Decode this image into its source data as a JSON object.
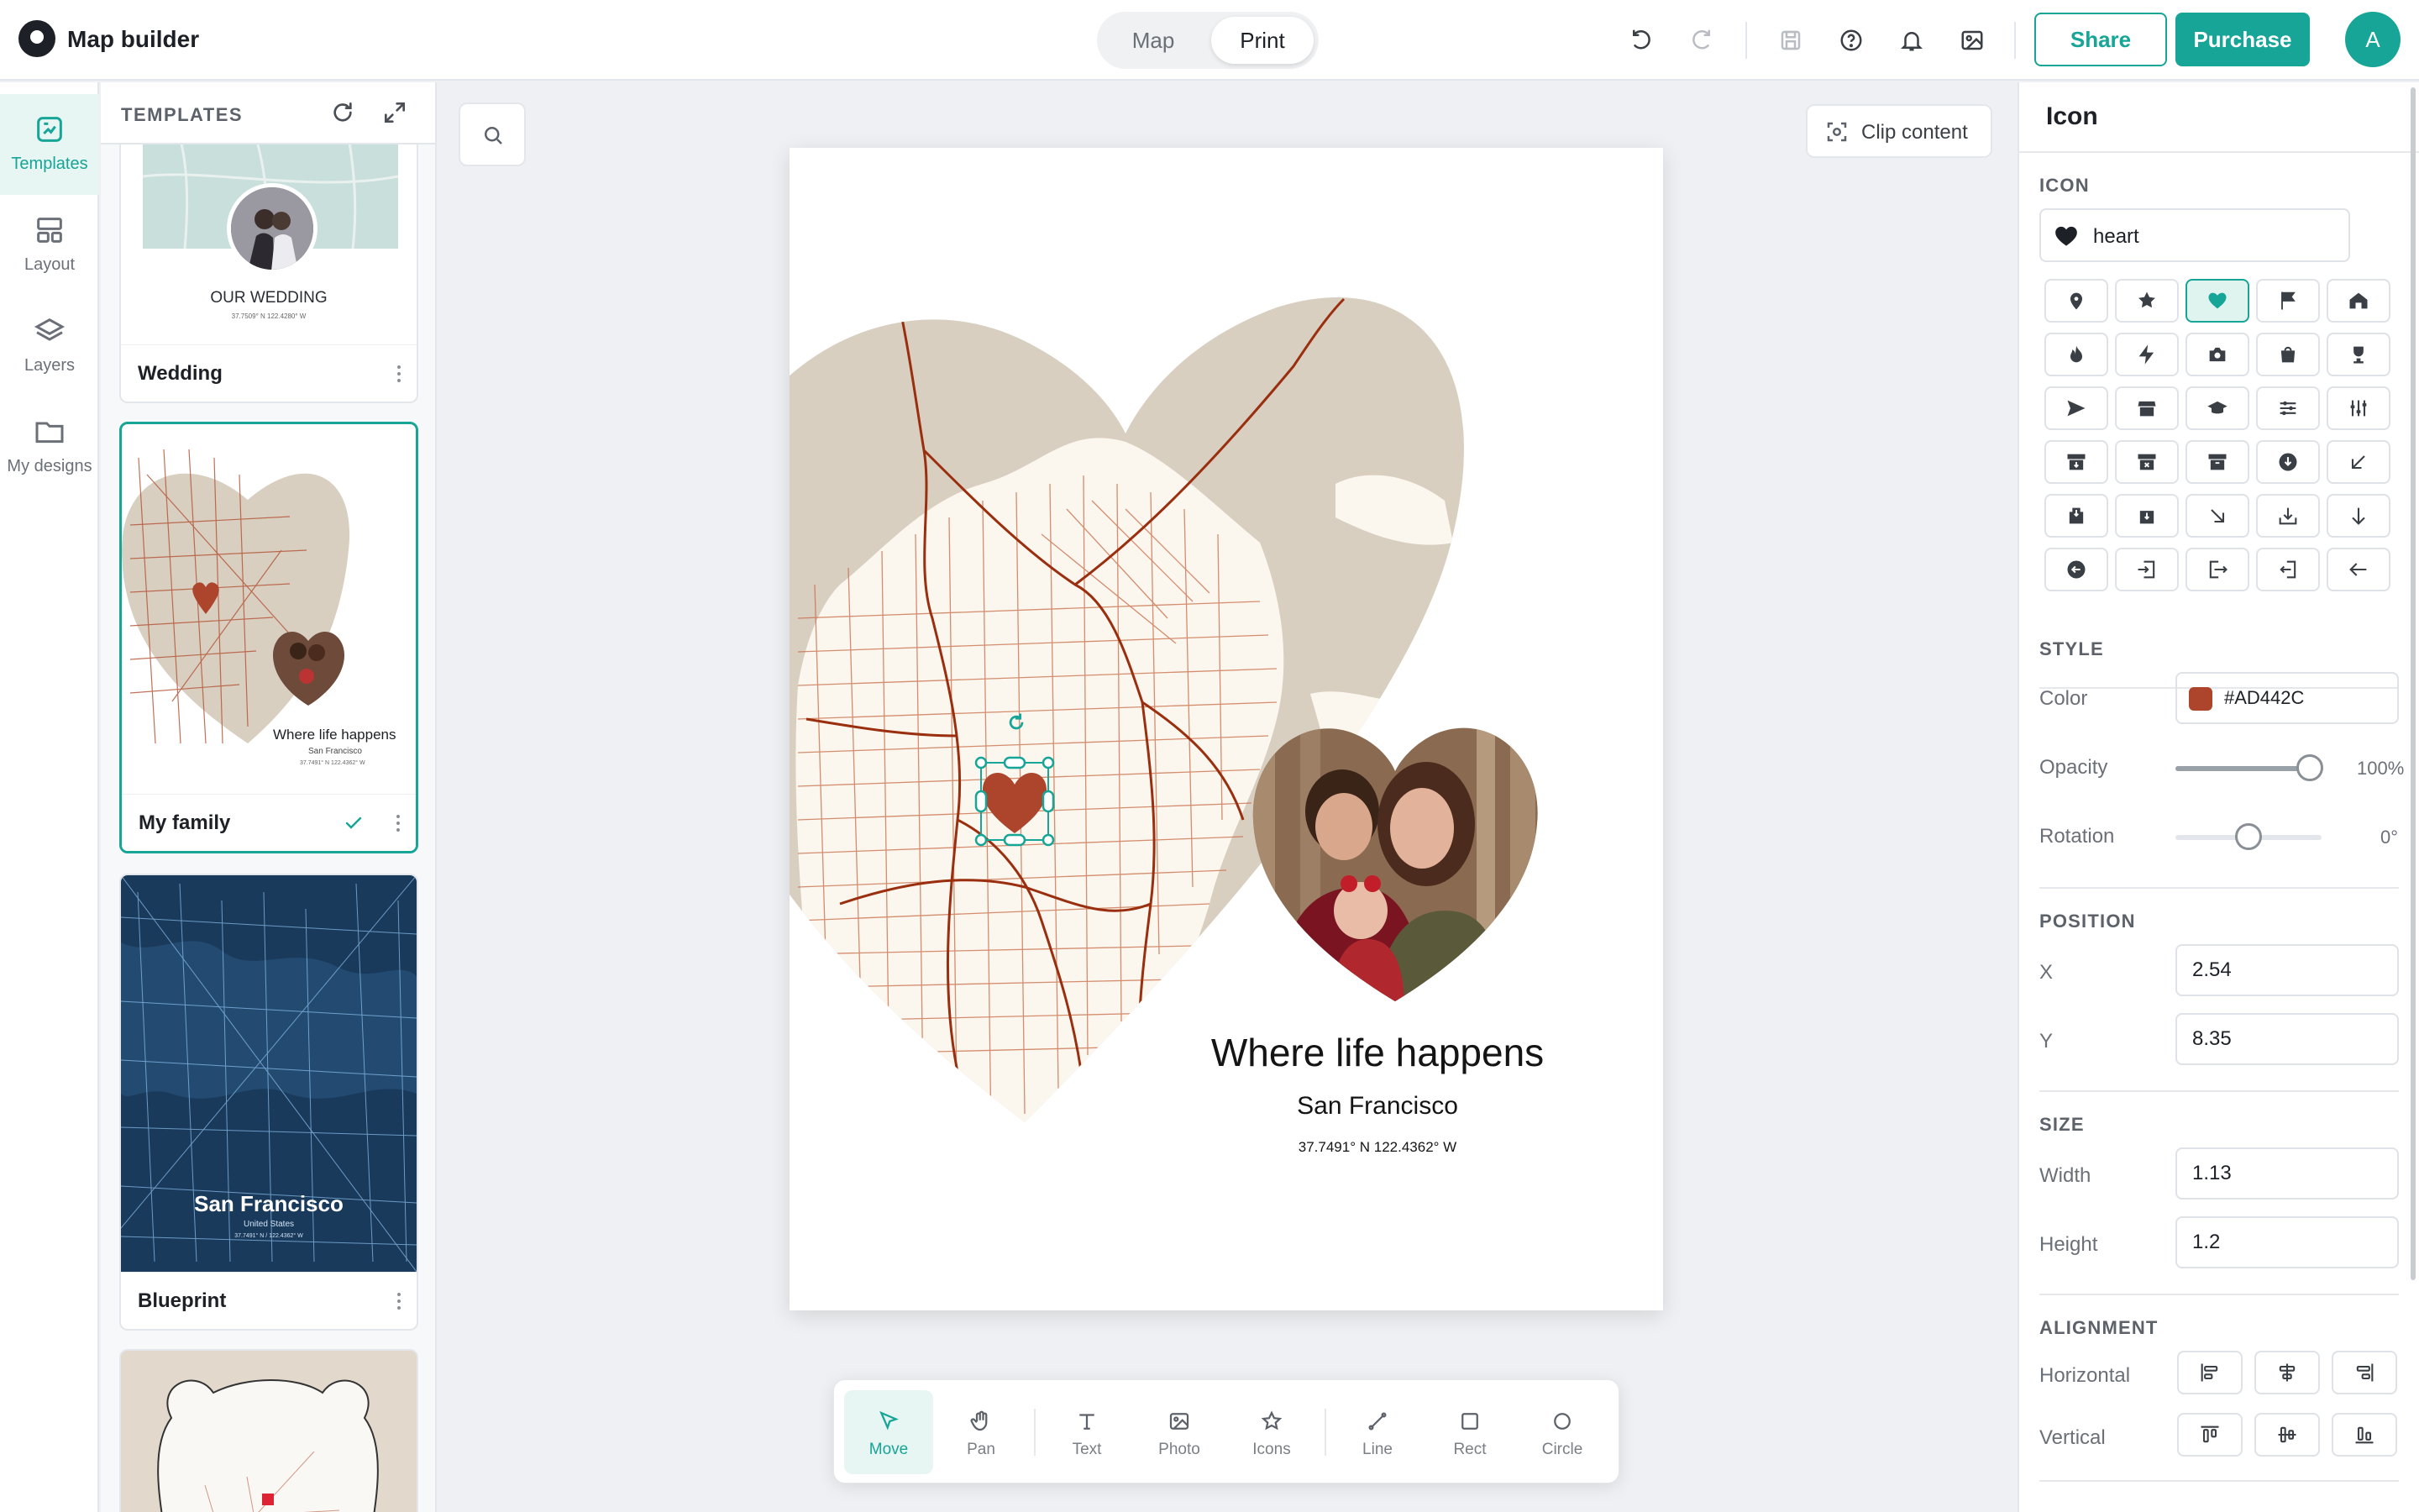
{
  "app": {
    "title": "Map builder"
  },
  "mode_switch": {
    "options": [
      "Map",
      "Print"
    ],
    "active": "Print"
  },
  "header": {
    "share_label": "Share",
    "purchase_label": "Purchase",
    "avatar_initial": "A"
  },
  "rail": {
    "items": [
      {
        "label": "Templates",
        "icon": "templates-icon",
        "active": true
      },
      {
        "label": "Layout",
        "icon": "layout-icon"
      },
      {
        "label": "Layers",
        "icon": "layers-icon"
      },
      {
        "label": "My designs",
        "icon": "folder-icon"
      }
    ]
  },
  "templates": {
    "heading": "TEMPLATES",
    "cards": [
      {
        "name": "Wedding",
        "preview_title": "OUR WEDDING",
        "preview_sub": "37.7509° N 122.4280° W"
      },
      {
        "name": "My family",
        "selected": true,
        "preview_title": "Where life happens",
        "preview_sub": "San Francisco",
        "preview_coords": "37.7491° N 122.4362° W"
      },
      {
        "name": "Blueprint",
        "preview_title": "San Francisco",
        "preview_sub": "United States",
        "preview_coords": "37.7491° N / 122.4362° W"
      },
      {
        "name": ""
      }
    ]
  },
  "canvas": {
    "clip_label": "Clip content",
    "poster": {
      "title": "Where life happens",
      "subtitle": "San Francisco",
      "coords": "37.7491° N  122.4362° W"
    },
    "colors": {
      "land": "#d8cfc1",
      "roads": "#9a2f0f",
      "water": "#fbf6ee",
      "marker": "#AD442C"
    }
  },
  "tools": [
    {
      "label": "Move",
      "icon": "cursor-icon",
      "active": true
    },
    {
      "label": "Pan",
      "icon": "hand-icon"
    },
    {
      "label": "Text",
      "icon": "text-icon"
    },
    {
      "label": "Photo",
      "icon": "photo-icon"
    },
    {
      "label": "Icons",
      "icon": "star-icon"
    },
    {
      "label": "Line",
      "icon": "line-icon"
    },
    {
      "label": "Rect",
      "icon": "rect-icon"
    },
    {
      "label": "Circle",
      "icon": "circle-icon"
    }
  ],
  "properties": {
    "title": "Icon",
    "icon_section": "ICON",
    "icon_value": "heart",
    "icon_grid": [
      "pin",
      "star",
      "heart",
      "flag",
      "home",
      "fire",
      "bolt",
      "camera",
      "bag",
      "trophy",
      "send",
      "store",
      "graduation",
      "sliders",
      "equalizer",
      "archive-down",
      "archive-x",
      "archive",
      "download-circle",
      "arrow-down-left",
      "hand-pointer",
      "bag-pointer",
      "arrow-down-right",
      "tray-download",
      "arrow-down",
      "arrow-left-circle",
      "door-in",
      "door-out",
      "door-left",
      "arrow-left"
    ],
    "icon_selected": "heart",
    "style_section": "STYLE",
    "color_label": "Color",
    "color_value": "#AD442C",
    "opacity_label": "Opacity",
    "opacity_value": "100%",
    "opacity": 100,
    "rotation_label": "Rotation",
    "rotation_value": "0°",
    "rotation_fraction": 0.5,
    "position_section": "POSITION",
    "x_label": "X",
    "x_value": "2.54",
    "y_label": "Y",
    "y_value": "8.35",
    "size_section": "SIZE",
    "width_label": "Width",
    "width_value": "1.13",
    "height_label": "Height",
    "height_value": "1.2",
    "alignment_section": "ALIGNMENT",
    "horizontal_label": "Horizontal",
    "vertical_label": "Vertical"
  }
}
